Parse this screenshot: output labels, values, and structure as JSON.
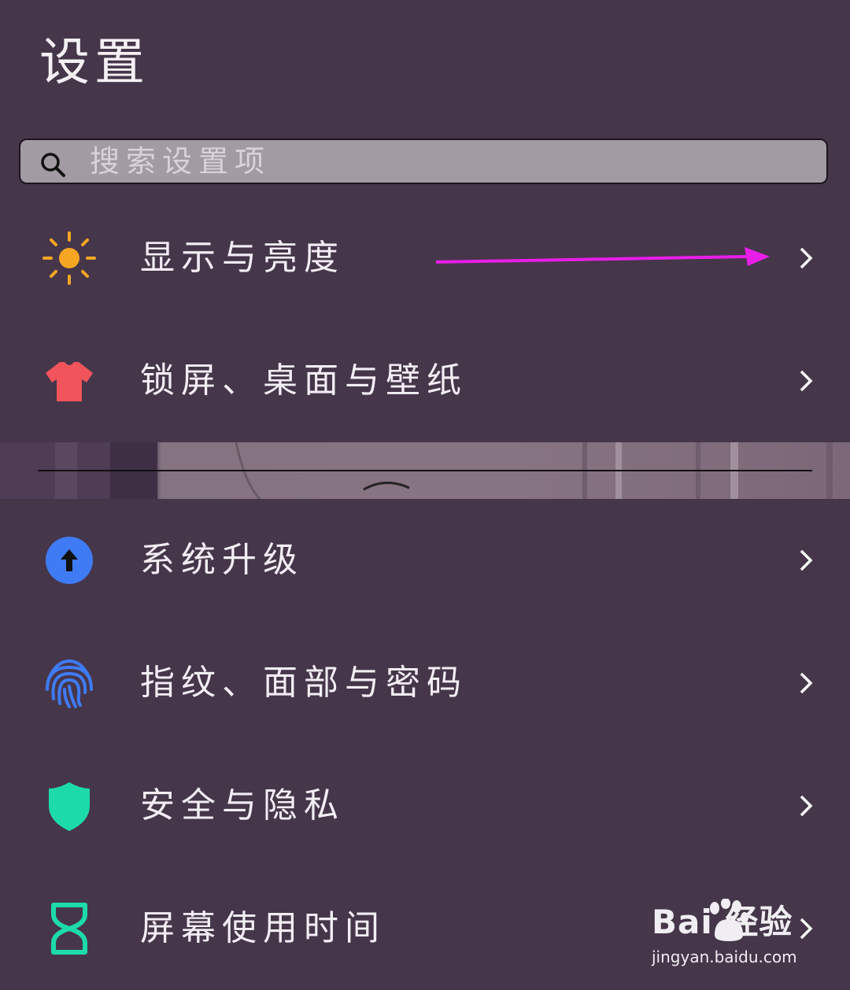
{
  "header": {
    "title": "设置"
  },
  "search": {
    "placeholder": "搜索设置项"
  },
  "settings": {
    "items": [
      {
        "label": "显示与亮度",
        "icon": "sun-icon",
        "color": "#f5a623"
      },
      {
        "label": "锁屏、桌面与壁纸",
        "icon": "tshirt-icon",
        "color": "#f2545b"
      },
      {
        "label": "系统升级",
        "icon": "upgrade-arrow-icon",
        "color": "#3f7bf5"
      },
      {
        "label": "指纹、面部与密码",
        "icon": "fingerprint-icon",
        "color": "#3f7bf5"
      },
      {
        "label": "安全与隐私",
        "icon": "shield-icon",
        "color": "#1ddba8"
      },
      {
        "label": "屏幕使用时间",
        "icon": "hourglass-icon",
        "color": "#1ddba8"
      }
    ]
  },
  "annotation": {
    "arrow_color": "#e81ee8"
  },
  "watermark": {
    "brand": "Bai  经验",
    "url": "jingyan.baidu.com"
  }
}
